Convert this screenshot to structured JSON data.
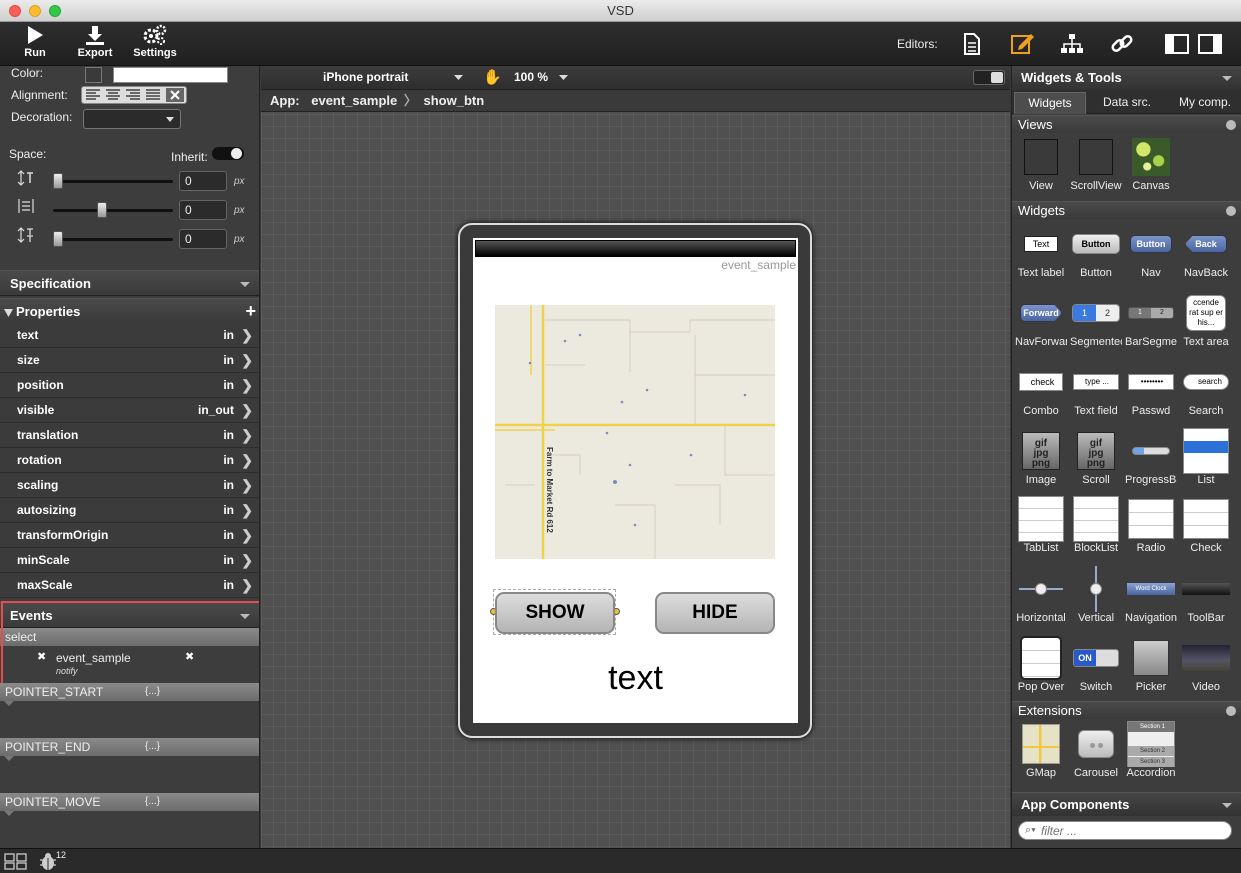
{
  "window": {
    "title": "VSD"
  },
  "toolbar": {
    "run": "Run",
    "export": "Export",
    "settings": "Settings",
    "editors_label": "Editors:"
  },
  "style": {
    "color_label": "Color:",
    "alignment_label": "Alignment:",
    "decoration_label": "Decoration:",
    "space_label": "Space:",
    "inherit_label": "Inherit:",
    "spacing": [
      {
        "value": "0",
        "unit": "px"
      },
      {
        "value": "0",
        "unit": "px"
      },
      {
        "value": "0",
        "unit": "px"
      }
    ]
  },
  "specification": {
    "title": "Specification"
  },
  "properties": {
    "title": "Properties",
    "items": [
      {
        "name": "text",
        "dir": "in"
      },
      {
        "name": "size",
        "dir": "in"
      },
      {
        "name": "position",
        "dir": "in"
      },
      {
        "name": "visible",
        "dir": "in_out"
      },
      {
        "name": "translation",
        "dir": "in"
      },
      {
        "name": "rotation",
        "dir": "in"
      },
      {
        "name": "scaling",
        "dir": "in"
      },
      {
        "name": "autosizing",
        "dir": "in"
      },
      {
        "name": "transformOrigin",
        "dir": "in"
      },
      {
        "name": "minScale",
        "dir": "in"
      },
      {
        "name": "maxScale",
        "dir": "in"
      }
    ]
  },
  "events": {
    "title": "Events",
    "select_label": "select",
    "handler_name": "event_sample",
    "handler_action": "notify",
    "list": [
      "POINTER_START",
      "POINTER_END",
      "POINTER_MOVE"
    ],
    "func_glyph": "{...}"
  },
  "canvas": {
    "device": "iPhone portrait",
    "zoom": "100 %",
    "breadcrumb_app": "App:",
    "breadcrumb_items": [
      "event_sample",
      "show_btn"
    ]
  },
  "preview": {
    "app_name": "event_sample",
    "map_road_label": "Farm to Market Rd 612",
    "show_button": "SHOW",
    "hide_button": "HIDE",
    "text_label": "text"
  },
  "right_panel": {
    "title": "Widgets & Tools",
    "tabs": [
      "Widgets",
      "Data src.",
      "My comp."
    ],
    "active_tab": 0,
    "sections": {
      "views": "Views",
      "widgets": "Widgets",
      "extensions": "Extensions",
      "app_components": "App Components"
    },
    "views": [
      "View",
      "ScrollView",
      "Canvas"
    ],
    "widgets": [
      "Text label",
      "Button",
      "Nav",
      "NavBack",
      "NavForwar",
      "Segmentec",
      "BarSegmer",
      "Text area",
      "Combo",
      "Text field",
      "Passwd",
      "Search",
      "Image",
      "Scroll",
      "ProgressBa",
      "List",
      "TabList",
      "BlockList",
      "Radio",
      "Check",
      "Horizontal",
      "Vertical",
      "Navigation",
      "ToolBar",
      "Pop Over",
      "Switch",
      "Picker",
      "Video"
    ],
    "widget_icon_texts": {
      "text": "Text",
      "button": "Button",
      "nav": "Button",
      "navback": "Back",
      "navforward": "Forward",
      "seg1": "1",
      "seg2": "2",
      "textarea": "ccende rat sup er his...",
      "combo": "check",
      "textfield": "type ...",
      "passwd": "••••••••",
      "search": "search",
      "switch_on": "ON",
      "navigation_title": "Word Clock"
    },
    "extensions": [
      "GMap",
      "Carousel",
      "Accordion"
    ],
    "accordion_sections": [
      "Section 1",
      "Section 2",
      "Section 3"
    ],
    "filter_placeholder": "filter ..."
  },
  "statusbar": {
    "badge": "12"
  },
  "colors": {
    "accent": "#f0a020",
    "highlight": "#e05050",
    "active_tab": "#4d4d4d"
  }
}
